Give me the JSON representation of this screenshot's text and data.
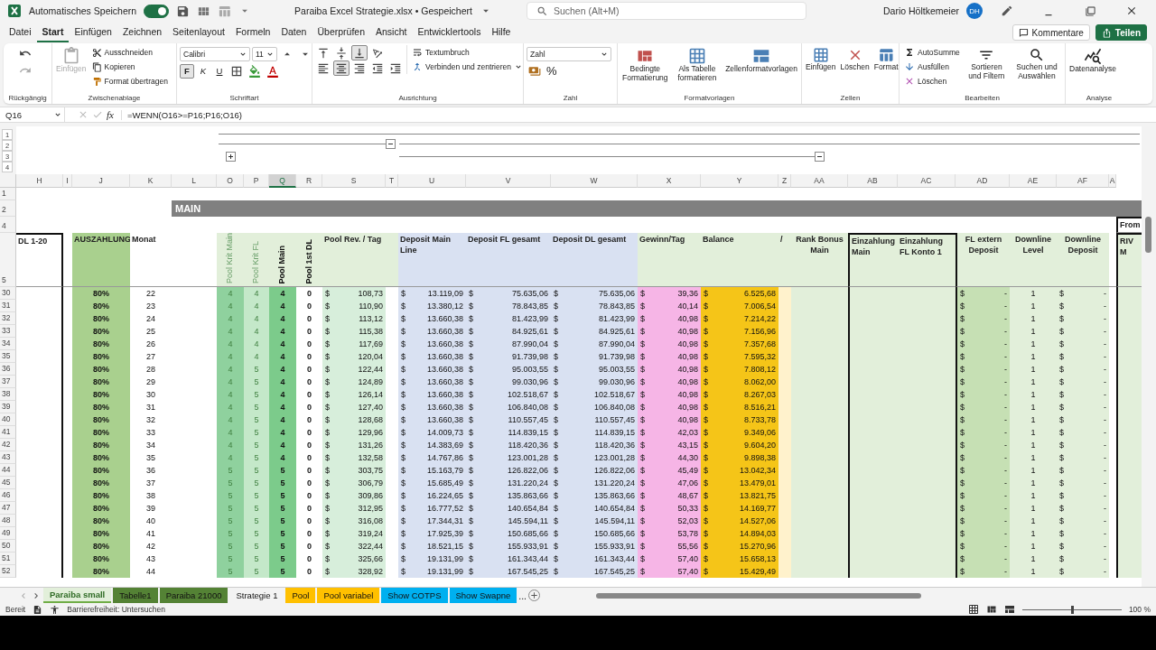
{
  "title_bar": {
    "autosave_label": "Automatisches Speichern",
    "autosave_on": true,
    "document_title": "Paraiba Excel Strategie.xlsx • Gespeichert",
    "search_placeholder": "Suchen (Alt+M)",
    "user_name": "Dario Höltkemeier",
    "user_initials": "DH"
  },
  "menu_tabs": [
    {
      "label": "Datei",
      "selected": false
    },
    {
      "label": "Start",
      "selected": true
    },
    {
      "label": "Einfügen",
      "selected": false
    },
    {
      "label": "Zeichnen",
      "selected": false
    },
    {
      "label": "Seitenlayout",
      "selected": false
    },
    {
      "label": "Formeln",
      "selected": false
    },
    {
      "label": "Daten",
      "selected": false
    },
    {
      "label": "Überprüfen",
      "selected": false
    },
    {
      "label": "Ansicht",
      "selected": false
    },
    {
      "label": "Entwicklertools",
      "selected": false
    },
    {
      "label": "Hilfe",
      "selected": false
    }
  ],
  "header_buttons": [
    {
      "label": "Kommentare",
      "kind": "comments"
    },
    {
      "label": "Teilen",
      "kind": "share"
    }
  ],
  "ribbon": {
    "undo_label": "Rückgängig",
    "clipboard": {
      "label": "Zwischenablage",
      "paste": {
        "label": "Einfügen",
        "disabled": true
      },
      "items": [
        "Ausschneiden",
        "Kopieren",
        "Format übertragen"
      ]
    },
    "font": {
      "label": "Schriftart",
      "family": "Calibri",
      "size": "11",
      "styles": [
        {
          "label": "F",
          "selected": true
        },
        {
          "label": "K",
          "selected": false
        },
        {
          "label": "U",
          "selected": false
        }
      ]
    },
    "alignment": {
      "label": "Ausrichtung",
      "vertical": [
        {
          "selected": false
        },
        {
          "selected": false
        },
        {
          "selected": true
        }
      ],
      "horizontal": [
        {
          "selected": false
        },
        {
          "selected": true
        },
        {
          "selected": false
        }
      ],
      "items": [
        "Textumbruch",
        "Verbinden und zentrieren"
      ]
    },
    "number": {
      "label": "Zahl",
      "format": "Zahl",
      "percent": "%"
    },
    "styles": {
      "label": "Formatvorlagen",
      "items": [
        "Bedingte Formatierung",
        "Als Tabelle formatieren",
        "Zellenformatvorlagen"
      ]
    },
    "cells": {
      "label": "Zellen",
      "items": [
        "Einfügen",
        "Löschen",
        "Format"
      ]
    },
    "editing": {
      "label": "Bearbeiten",
      "small_items": [
        "AutoSumme",
        "Ausfüllen",
        "Löschen"
      ],
      "items": [
        "Sortieren und Filtern",
        "Suchen und Auswählen"
      ]
    },
    "analysis": {
      "label": "Analyse",
      "items": [
        "Datenanalyse"
      ]
    }
  },
  "formula_bar": {
    "name_box": "Q16",
    "fx": "fx",
    "formula": "=WENN(O16>=P16;P16;O16)"
  },
  "outline_levels": [
    "1",
    "2",
    "3",
    "4"
  ],
  "columns": [
    {
      "letter": "H",
      "selected": false
    },
    {
      "letter": "I",
      "selected": false
    },
    {
      "letter": "J",
      "selected": false
    },
    {
      "letter": "K",
      "selected": false
    },
    {
      "letter": "L",
      "selected": false
    },
    {
      "letter": "O",
      "selected": false
    },
    {
      "letter": "P",
      "selected": false
    },
    {
      "letter": "Q",
      "selected": true
    },
    {
      "letter": "R",
      "selected": false
    },
    {
      "letter": "S",
      "selected": false
    },
    {
      "letter": "T",
      "selected": false
    },
    {
      "letter": "U",
      "selected": false
    },
    {
      "letter": "V",
      "selected": false
    },
    {
      "letter": "W",
      "selected": false
    },
    {
      "letter": "X",
      "selected": false
    },
    {
      "letter": "Y",
      "selected": false
    },
    {
      "letter": "Z",
      "selected": false
    },
    {
      "letter": "AA",
      "selected": false
    },
    {
      "letter": "AB",
      "selected": false
    },
    {
      "letter": "AC",
      "selected": false
    },
    {
      "letter": "AD",
      "selected": false
    },
    {
      "letter": "AE",
      "selected": false
    },
    {
      "letter": "AF",
      "selected": false
    },
    {
      "letter": "A",
      "selected": false
    }
  ],
  "top_row_numbers": [
    "1",
    "2",
    "4",
    "5"
  ],
  "banner": "MAIN",
  "side_header": "From",
  "headers": [
    {
      "text": "DL 1-20",
      "kind": "normal"
    },
    {
      "text": "AUSZAHLUNG",
      "kind": "normal"
    },
    {
      "text": "Monat",
      "kind": "normal"
    },
    {
      "text": "Pool Krit Main",
      "kind": "vertical"
    },
    {
      "text": "Pool Krit FL",
      "kind": "vertical"
    },
    {
      "text": "Pool Main",
      "kind": "vertical"
    },
    {
      "text": "Pool 1st DL",
      "kind": "vertical"
    },
    {
      "text": "Pool Rev. / Tag",
      "kind": "normal"
    },
    {
      "text": "Deposit Main Line",
      "kind": "normal"
    },
    {
      "text": "Deposit FL gesamt",
      "kind": "normal"
    },
    {
      "text": "Deposit DL gesamt",
      "kind": "normal"
    },
    {
      "text": "Gewinn/Tag",
      "kind": "normal"
    },
    {
      "text": "Balance",
      "kind": "normal"
    },
    {
      "text": "/",
      "kind": "normal"
    },
    {
      "text": "Rank Bonus Main",
      "kind": "center"
    },
    {
      "text": "Einzahlung Main",
      "kind": "normal"
    },
    {
      "text": "Einzahlung FL Konto 1",
      "kind": "normal"
    },
    {
      "text": "FL extern Deposit",
      "kind": "center"
    },
    {
      "text": "Downline Level",
      "kind": "center"
    },
    {
      "text": "Downline Deposit",
      "kind": "center"
    },
    {
      "text": "RIV M",
      "kind": "normal"
    }
  ],
  "rows": [
    {
      "number": "30",
      "cells": [
        "80%",
        "22",
        "4",
        "4",
        "4",
        "0",
        "$ 108,73",
        "$ 13.119,09",
        "$ 75.635,06",
        "$ 75.635,06",
        "$ 39,36",
        "$ 6.525,68",
        "$ -",
        "1",
        "$ -"
      ]
    },
    {
      "number": "31",
      "cells": [
        "80%",
        "23",
        "4",
        "4",
        "4",
        "0",
        "$ 110,90",
        "$ 13.380,12",
        "$ 78.843,85",
        "$ 78.843,85",
        "$ 40,14",
        "$ 7.006,54",
        "$ -",
        "1",
        "$ -"
      ]
    },
    {
      "number": "32",
      "cells": [
        "80%",
        "24",
        "4",
        "4",
        "4",
        "0",
        "$ 113,12",
        "$ 13.660,38",
        "$ 81.423,99",
        "$ 81.423,99",
        "$ 40,98",
        "$ 7.214,22",
        "$ -",
        "1",
        "$ -"
      ]
    },
    {
      "number": "33",
      "cells": [
        "80%",
        "25",
        "4",
        "4",
        "4",
        "0",
        "$ 115,38",
        "$ 13.660,38",
        "$ 84.925,61",
        "$ 84.925,61",
        "$ 40,98",
        "$ 7.156,96",
        "$ -",
        "1",
        "$ -"
      ]
    },
    {
      "number": "34",
      "cells": [
        "80%",
        "26",
        "4",
        "4",
        "4",
        "0",
        "$ 117,69",
        "$ 13.660,38",
        "$ 87.990,04",
        "$ 87.990,04",
        "$ 40,98",
        "$ 7.357,68",
        "$ -",
        "1",
        "$ -"
      ]
    },
    {
      "number": "35",
      "cells": [
        "80%",
        "27",
        "4",
        "4",
        "4",
        "0",
        "$ 120,04",
        "$ 13.660,38",
        "$ 91.739,98",
        "$ 91.739,98",
        "$ 40,98",
        "$ 7.595,32",
        "$ -",
        "1",
        "$ -"
      ]
    },
    {
      "number": "36",
      "cells": [
        "80%",
        "28",
        "4",
        "5",
        "4",
        "0",
        "$ 122,44",
        "$ 13.660,38",
        "$ 95.003,55",
        "$ 95.003,55",
        "$ 40,98",
        "$ 7.808,12",
        "$ -",
        "1",
        "$ -"
      ]
    },
    {
      "number": "37",
      "cells": [
        "80%",
        "29",
        "4",
        "5",
        "4",
        "0",
        "$ 124,89",
        "$ 13.660,38",
        "$ 99.030,96",
        "$ 99.030,96",
        "$ 40,98",
        "$ 8.062,00",
        "$ -",
        "1",
        "$ -"
      ]
    },
    {
      "number": "38",
      "cells": [
        "80%",
        "30",
        "4",
        "5",
        "4",
        "0",
        "$ 126,14",
        "$ 13.660,38",
        "$ 102.518,67",
        "$ 102.518,67",
        "$ 40,98",
        "$ 8.267,03",
        "$ -",
        "1",
        "$ -"
      ]
    },
    {
      "number": "39",
      "cells": [
        "80%",
        "31",
        "4",
        "5",
        "4",
        "0",
        "$ 127,40",
        "$ 13.660,38",
        "$ 106.840,08",
        "$ 106.840,08",
        "$ 40,98",
        "$ 8.516,21",
        "$ -",
        "1",
        "$ -"
      ]
    },
    {
      "number": "40",
      "cells": [
        "80%",
        "32",
        "4",
        "5",
        "4",
        "0",
        "$ 128,68",
        "$ 13.660,38",
        "$ 110.557,45",
        "$ 110.557,45",
        "$ 40,98",
        "$ 8.733,78",
        "$ -",
        "1",
        "$ -"
      ]
    },
    {
      "number": "41",
      "cells": [
        "80%",
        "33",
        "4",
        "5",
        "4",
        "0",
        "$ 129,96",
        "$ 14.009,73",
        "$ 114.839,15",
        "$ 114.839,15",
        "$ 42,03",
        "$ 9.349,06",
        "$ -",
        "1",
        "$ -"
      ]
    },
    {
      "number": "42",
      "cells": [
        "80%",
        "34",
        "4",
        "5",
        "4",
        "0",
        "$ 131,26",
        "$ 14.383,69",
        "$ 118.420,36",
        "$ 118.420,36",
        "$ 43,15",
        "$ 9.604,20",
        "$ -",
        "1",
        "$ -"
      ]
    },
    {
      "number": "43",
      "cells": [
        "80%",
        "35",
        "4",
        "5",
        "4",
        "0",
        "$ 132,58",
        "$ 14.767,86",
        "$ 123.001,28",
        "$ 123.001,28",
        "$ 44,30",
        "$ 9.898,38",
        "$ -",
        "1",
        "$ -"
      ]
    },
    {
      "number": "44",
      "cells": [
        "80%",
        "36",
        "5",
        "5",
        "5",
        "0",
        "$ 303,75",
        "$ 15.163,79",
        "$ 126.822,06",
        "$ 126.822,06",
        "$ 45,49",
        "$ 13.042,34",
        "$ -",
        "1",
        "$ -"
      ]
    },
    {
      "number": "45",
      "cells": [
        "80%",
        "37",
        "5",
        "5",
        "5",
        "0",
        "$ 306,79",
        "$ 15.685,49",
        "$ 131.220,24",
        "$ 131.220,24",
        "$ 47,06",
        "$ 13.479,01",
        "$ -",
        "1",
        "$ -"
      ]
    },
    {
      "number": "46",
      "cells": [
        "80%",
        "38",
        "5",
        "5",
        "5",
        "0",
        "$ 309,86",
        "$ 16.224,65",
        "$ 135.863,66",
        "$ 135.863,66",
        "$ 48,67",
        "$ 13.821,75",
        "$ -",
        "1",
        "$ -"
      ]
    },
    {
      "number": "47",
      "cells": [
        "80%",
        "39",
        "5",
        "5",
        "5",
        "0",
        "$ 312,95",
        "$ 16.777,52",
        "$ 140.654,84",
        "$ 140.654,84",
        "$ 50,33",
        "$ 14.169,77",
        "$ -",
        "1",
        "$ -"
      ]
    },
    {
      "number": "48",
      "cells": [
        "80%",
        "40",
        "5",
        "5",
        "5",
        "0",
        "$ 316,08",
        "$ 17.344,31",
        "$ 145.594,11",
        "$ 145.594,11",
        "$ 52,03",
        "$ 14.527,06",
        "$ -",
        "1",
        "$ -"
      ]
    },
    {
      "number": "49",
      "cells": [
        "80%",
        "41",
        "5",
        "5",
        "5",
        "0",
        "$ 319,24",
        "$ 17.925,39",
        "$ 150.685,66",
        "$ 150.685,66",
        "$ 53,78",
        "$ 14.894,03",
        "$ -",
        "1",
        "$ -"
      ]
    },
    {
      "number": "50",
      "cells": [
        "80%",
        "42",
        "5",
        "5",
        "5",
        "0",
        "$ 322,44",
        "$ 18.521,15",
        "$ 155.933,91",
        "$ 155.933,91",
        "$ 55,56",
        "$ 15.270,96",
        "$ -",
        "1",
        "$ -"
      ]
    },
    {
      "number": "51",
      "cells": [
        "80%",
        "43",
        "5",
        "5",
        "5",
        "0",
        "$ 325,66",
        "$ 19.131,99",
        "$ 161.343,44",
        "$ 161.343,44",
        "$ 57,40",
        "$ 15.658,13",
        "$ -",
        "1",
        "$ -"
      ]
    },
    {
      "number": "52",
      "cells": [
        "80%",
        "44",
        "5",
        "5",
        "5",
        "0",
        "$ 328,92",
        "$ 19.131,99",
        "$ 167.545,25",
        "$ 167.545,25",
        "$ 57,40",
        "$ 15.429,49",
        "$ -",
        "1",
        "$ -"
      ]
    }
  ],
  "sheet_tabs": [
    {
      "label": "Paraiba small",
      "color": "#70ad47",
      "selected": true
    },
    {
      "label": "Tabelle1",
      "color": "#548235",
      "selected": false
    },
    {
      "label": "Paraiba 21000",
      "color": "#548235",
      "selected": false
    },
    {
      "label": "Strategie 1",
      "selected": false
    },
    {
      "label": "Pool",
      "color": "#ffc000",
      "selected": false
    },
    {
      "label": "Pool variabel",
      "color": "#ffc000",
      "selected": false
    },
    {
      "label": "Show COTPS",
      "color": "#00b0f0",
      "selected": false
    },
    {
      "label": "Show Swapne",
      "color": "#00b0f0",
      "selected": false
    }
  ],
  "more_tabs": "...",
  "status_bar": {
    "ready": "Bereit",
    "accessibility": "Barrierefreiheit: Untersuchen",
    "zoom_slider": {
      "level": 0.5
    },
    "zoom": "100 %"
  }
}
